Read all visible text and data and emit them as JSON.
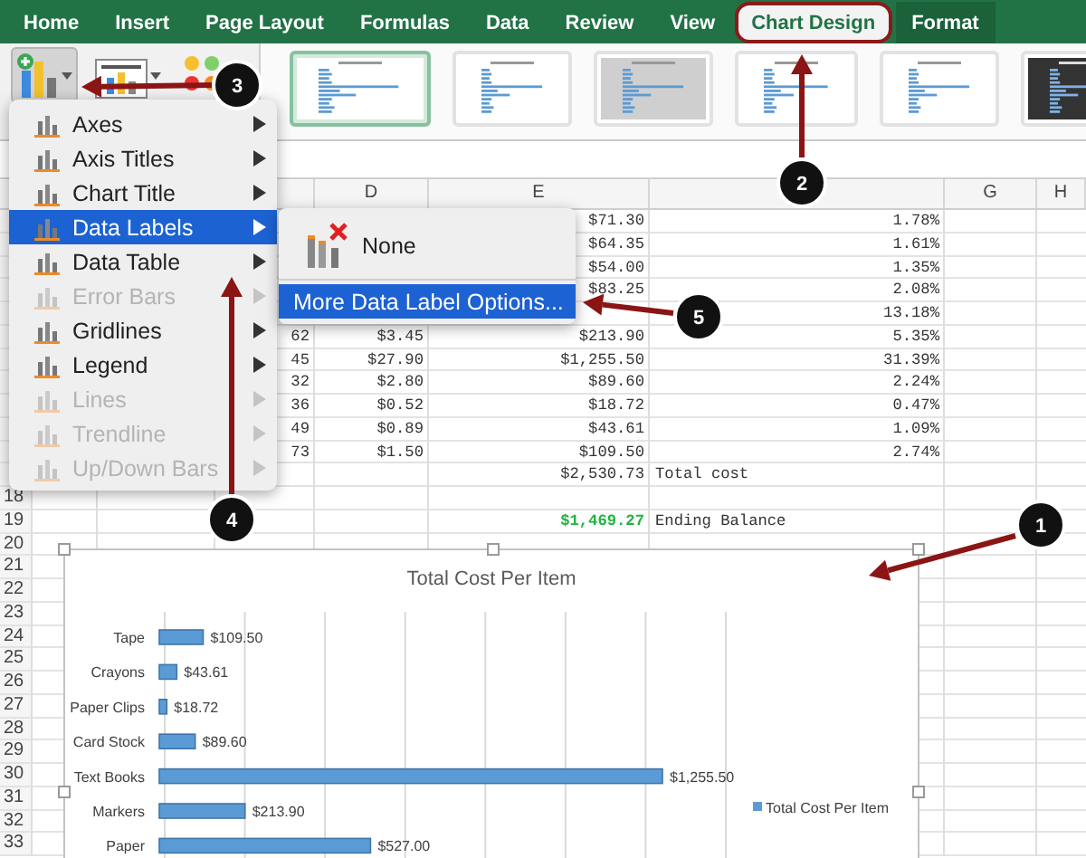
{
  "tabs": [
    {
      "label": "Home",
      "selected": false,
      "contextual": false,
      "outlined": false
    },
    {
      "label": "Insert",
      "selected": false,
      "contextual": false,
      "outlined": false
    },
    {
      "label": "Page Layout",
      "selected": false,
      "contextual": false,
      "outlined": false
    },
    {
      "label": "Formulas",
      "selected": false,
      "contextual": false,
      "outlined": false
    },
    {
      "label": "Data",
      "selected": false,
      "contextual": false,
      "outlined": false
    },
    {
      "label": "Review",
      "selected": false,
      "contextual": false,
      "outlined": false
    },
    {
      "label": "View",
      "selected": false,
      "contextual": false,
      "outlined": false
    },
    {
      "label": "Chart Design",
      "selected": true,
      "contextual": true,
      "outlined": true
    },
    {
      "label": "Format",
      "selected": false,
      "contextual": true,
      "outlined": false
    }
  ],
  "ribbon": {
    "buttons": [
      {
        "kind": "add_chart_element",
        "pressed": true
      },
      {
        "kind": "quick_layout",
        "pressed": false
      },
      {
        "kind": "change_colors",
        "pressed": false
      }
    ],
    "chart_styles": [
      {
        "kind": "light",
        "selected": true
      },
      {
        "kind": "light",
        "selected": false
      },
      {
        "kind": "gray",
        "selected": false
      },
      {
        "kind": "light",
        "selected": false
      },
      {
        "kind": "light",
        "selected": false
      },
      {
        "kind": "dark",
        "selected": false
      }
    ]
  },
  "sheet": {
    "column_headers": {
      "D": "D",
      "E": "E",
      "G": "G",
      "H": "H"
    },
    "rows": [
      {
        "kind": "data",
        "cells": {
          "E": "$71.30",
          "F": "1.78%"
        }
      },
      {
        "kind": "data",
        "cells": {
          "E": "$64.35",
          "F": "1.61%"
        }
      },
      {
        "kind": "data",
        "cells": {
          "E": "$54.00",
          "F": "1.35%"
        }
      },
      {
        "kind": "data",
        "cells": {
          "E": "$83.25",
          "F": "2.08%"
        }
      },
      {
        "kind": "data",
        "cells": {
          "F": "13.18%"
        }
      },
      {
        "kind": "data",
        "cells": {
          "C": "62",
          "D": "$3.45",
          "E": "$213.90",
          "F": "5.35%"
        }
      },
      {
        "kind": "data",
        "cells": {
          "C": "45",
          "D": "$27.90",
          "E": "$1,255.50",
          "F": "31.39%"
        }
      },
      {
        "kind": "data",
        "cells": {
          "C": "32",
          "D": "$2.80",
          "E": "$89.60",
          "F": "2.24%"
        }
      },
      {
        "kind": "data",
        "cells": {
          "C": "36",
          "D": "$0.52",
          "E": "$18.72",
          "F": "0.47%"
        }
      },
      {
        "kind": "data",
        "cells": {
          "C": "49",
          "D": "$0.89",
          "E": "$43.61",
          "F": "1.09%"
        }
      },
      {
        "kind": "data",
        "cells": {
          "C": "73",
          "D": "$1.50",
          "E": "$109.50",
          "F": "2.74%"
        }
      },
      {
        "kind": "total",
        "cells": {
          "E": "$2,530.73",
          "F": "Total cost"
        }
      },
      {
        "kind": "blank",
        "row": "18",
        "cells": {}
      },
      {
        "kind": "balance",
        "row": "19",
        "cells": {
          "E": "$1,469.27",
          "F": "Ending Balance"
        }
      },
      {
        "kind": "blank",
        "row": "20",
        "cells": {}
      },
      {
        "kind": "blank",
        "row": "21",
        "cells": {}
      },
      {
        "kind": "blank",
        "row": "22",
        "cells": {}
      },
      {
        "kind": "blank",
        "row": "23",
        "cells": {}
      },
      {
        "kind": "blank",
        "row": "24",
        "cells": {}
      },
      {
        "kind": "blank",
        "row": "25",
        "cells": {}
      },
      {
        "kind": "blank",
        "row": "26",
        "cells": {}
      },
      {
        "kind": "blank",
        "row": "27",
        "cells": {}
      },
      {
        "kind": "blank",
        "row": "28",
        "cells": {}
      },
      {
        "kind": "blank",
        "row": "29",
        "cells": {}
      },
      {
        "kind": "blank",
        "row": "30",
        "cells": {}
      },
      {
        "kind": "blank",
        "row": "31",
        "cells": {}
      },
      {
        "kind": "blank",
        "row": "32",
        "cells": {}
      },
      {
        "kind": "blank",
        "row": "33",
        "cells": {}
      }
    ]
  },
  "chart": {
    "chart_data": {
      "type": "bar",
      "orientation": "horizontal",
      "title": "Total Cost Per Item",
      "categories": [
        "Tape",
        "Crayons",
        "Paper Clips",
        "Card Stock",
        "Text Books",
        "Markers",
        "Paper"
      ],
      "series": [
        {
          "name": "Total Cost Per Item",
          "color": "#5b9bd5",
          "values": [
            109.5,
            43.61,
            18.72,
            89.6,
            1255.5,
            213.9,
            527
          ],
          "value_labels": [
            "$109.50",
            "$43.61",
            "$18.72",
            "$89.60",
            "$1,255.50",
            "$213.90",
            "$527.00"
          ]
        }
      ],
      "data_labels": true
    }
  },
  "menu": {
    "items": [
      {
        "label": "Axes",
        "selected": false,
        "disabled": false
      },
      {
        "label": "Axis Titles",
        "selected": false,
        "disabled": false
      },
      {
        "label": "Chart Title",
        "selected": false,
        "disabled": false
      },
      {
        "label": "Data Labels",
        "selected": true,
        "disabled": false
      },
      {
        "label": "Data Table",
        "selected": false,
        "disabled": false
      },
      {
        "label": "Error Bars",
        "selected": false,
        "disabled": true
      },
      {
        "label": "Gridlines",
        "selected": false,
        "disabled": false
      },
      {
        "label": "Legend",
        "selected": false,
        "disabled": false
      },
      {
        "label": "Lines",
        "selected": false,
        "disabled": true
      },
      {
        "label": "Trendline",
        "selected": false,
        "disabled": true
      },
      {
        "label": "Up/Down Bars",
        "selected": false,
        "disabled": true
      }
    ]
  },
  "submenu": {
    "items": [
      {
        "label": "None",
        "kind": "option",
        "selected": false
      },
      {
        "label": "More Data Label Options...",
        "kind": "command",
        "selected": true
      }
    ]
  },
  "callouts": [
    {
      "label": "1"
    },
    {
      "label": "2"
    },
    {
      "label": "3"
    },
    {
      "label": "4"
    },
    {
      "label": "5"
    }
  ]
}
